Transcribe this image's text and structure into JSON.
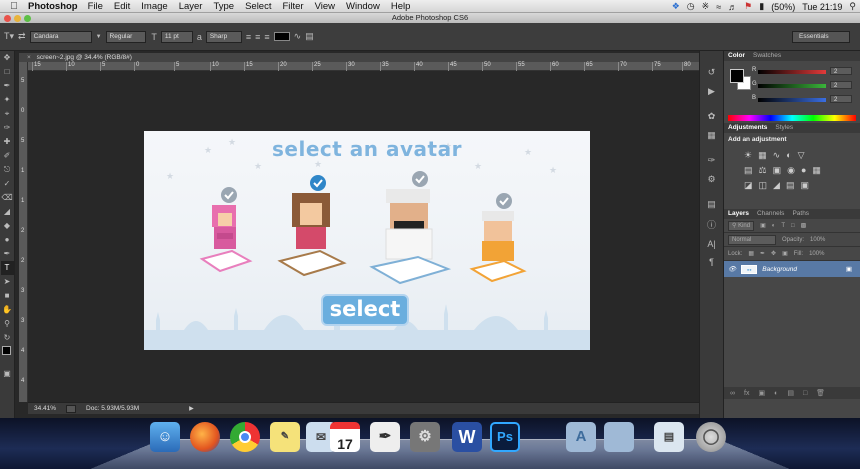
{
  "menubar": {
    "app_name": "Photoshop",
    "items": [
      "File",
      "Edit",
      "Image",
      "Layer",
      "Type",
      "Select",
      "Filter",
      "View",
      "Window",
      "Help"
    ],
    "battery": "(50%)",
    "clock": "Tue 21:19"
  },
  "window": {
    "title": "Adobe Photoshop CS6"
  },
  "options_bar": {
    "font_family": "Candara",
    "font_style": "Regular",
    "font_size": "11 pt",
    "antialias": "Sharp",
    "workspace": "Essentials"
  },
  "document": {
    "tab_label": "screen~2.jpg @ 34.4% (RGB/8#)",
    "ruler_h": [
      "15",
      "10",
      "5",
      "0",
      "5",
      "10",
      "15",
      "20",
      "25",
      "30",
      "35",
      "40",
      "45",
      "50",
      "55",
      "60",
      "65",
      "70",
      "75",
      "80"
    ],
    "ruler_v": [
      "5",
      "0",
      "5",
      "1",
      "1",
      "2",
      "2",
      "3",
      "3",
      "4",
      "4"
    ],
    "canvas": {
      "heading": "select an avatar",
      "button_label": "select"
    }
  },
  "statusbar": {
    "zoom": "34.41%",
    "doc_size": "Doc: 5.93M/5.93M"
  },
  "panels": {
    "color_tabs": [
      "Color",
      "Swatches"
    ],
    "sliders": [
      {
        "label": "R",
        "value": "2",
        "color": "#e23a3a"
      },
      {
        "label": "G",
        "value": "2",
        "color": "#3ab53a"
      },
      {
        "label": "B",
        "value": "2",
        "color": "#3a6ee2"
      }
    ],
    "adjustments_tabs": [
      "Adjustments",
      "Styles"
    ],
    "adjustments_title": "Add an adjustment",
    "layers_tabs": [
      "Layers",
      "Channels",
      "Paths"
    ],
    "layers_kind": "Kind",
    "blend_mode": "Normal",
    "opacity_label": "Opacity:",
    "opacity_value": "100%",
    "lock_label": "Lock:",
    "fill_label": "Fill:",
    "fill_value": "100%",
    "layer_name": "Background"
  },
  "dock": {
    "ps_label": "Ps",
    "w_label": "W",
    "calendar_day": "17"
  }
}
